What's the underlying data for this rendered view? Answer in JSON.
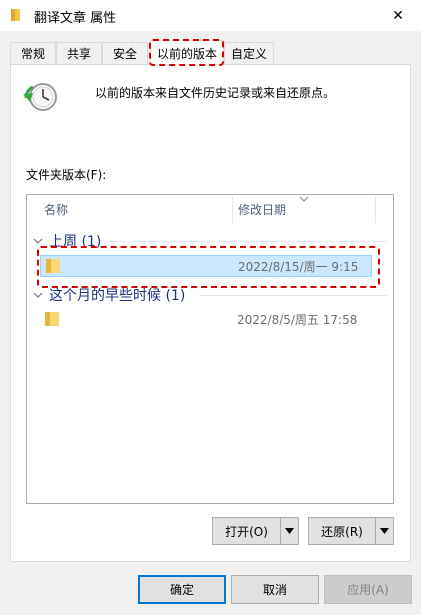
{
  "window": {
    "title": "翻译文章 属性",
    "icon": "folder-icon",
    "close_glyph": "✕"
  },
  "tabs": [
    {
      "label": "常规",
      "active": false
    },
    {
      "label": "共享",
      "active": false
    },
    {
      "label": "安全",
      "active": false
    },
    {
      "label": "以前的版本",
      "active": true
    },
    {
      "label": "自定义",
      "active": false
    }
  ],
  "description": "以前的版本来自文件历史记录或来自还原点。",
  "versions_label": "文件夹版本(F):",
  "list": {
    "columns": [
      "名称",
      "修改日期"
    ],
    "groups": [
      {
        "header": "上周 (1)",
        "rows": [
          {
            "name": "",
            "date": "2022/8/15/周一 9:15",
            "selected": true
          }
        ]
      },
      {
        "header": "这个月的早些时候 (1)",
        "rows": [
          {
            "name": "",
            "date": "2022/8/5/周五 17:58",
            "selected": false
          }
        ]
      }
    ]
  },
  "buttons": {
    "open": "打开(O)",
    "restore": "还原(R)",
    "ok": "确定",
    "cancel": "取消",
    "apply": "应用(A)"
  },
  "colors": {
    "accent": "#0078d7",
    "selection": "#cce8ff",
    "highlight": "#d70000",
    "group_header": "#1e3287"
  }
}
